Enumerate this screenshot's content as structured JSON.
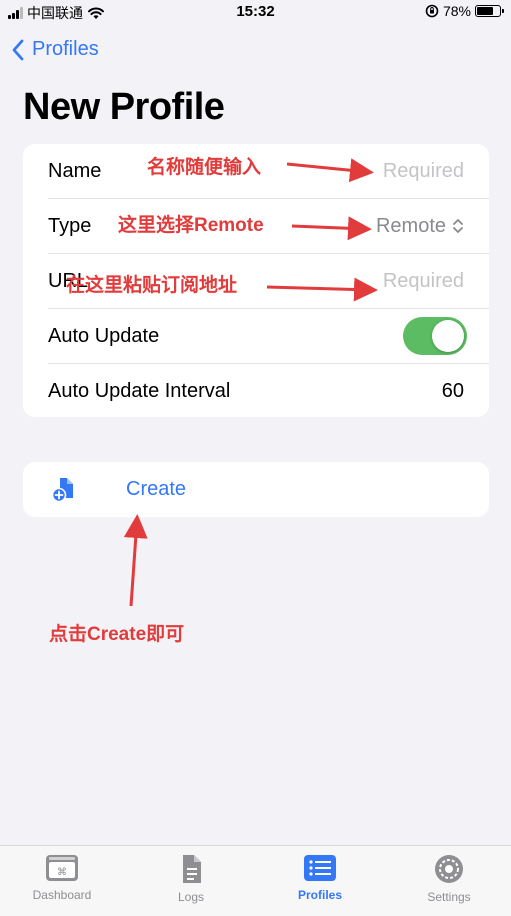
{
  "status_bar": {
    "carrier": "中国联通",
    "time": "15:32",
    "battery": "78%",
    "battery_level": 0.78
  },
  "nav": {
    "back_label": "Profiles",
    "title": "New Profile"
  },
  "form": {
    "name": {
      "label": "Name",
      "placeholder": "Required"
    },
    "type": {
      "label": "Type",
      "value": "Remote"
    },
    "url": {
      "label": "URL",
      "placeholder": "Required"
    },
    "auto_update": {
      "label": "Auto Update",
      "enabled": true
    },
    "auto_update_interval": {
      "label": "Auto Update Interval",
      "value": "60"
    }
  },
  "create_button": {
    "label": "Create",
    "icon": "doc-plus-icon"
  },
  "annotations": {
    "name_hint": "名称随便输入",
    "type_hint": "这里选择Remote",
    "url_hint": "在这里粘贴订阅地址",
    "create_hint": "点击Create即可"
  },
  "tabs": [
    {
      "label": "Dashboard",
      "icon": "dashboard-icon",
      "active": false
    },
    {
      "label": "Logs",
      "icon": "logs-icon",
      "active": false
    },
    {
      "label": "Profiles",
      "icon": "profiles-icon",
      "active": true
    },
    {
      "label": "Settings",
      "icon": "settings-icon",
      "active": false
    }
  ],
  "colors": {
    "accent": "#3478f6",
    "toggle_on": "#5cbc63",
    "annotation": "#e23b3b",
    "background": "#f2f2f7"
  }
}
